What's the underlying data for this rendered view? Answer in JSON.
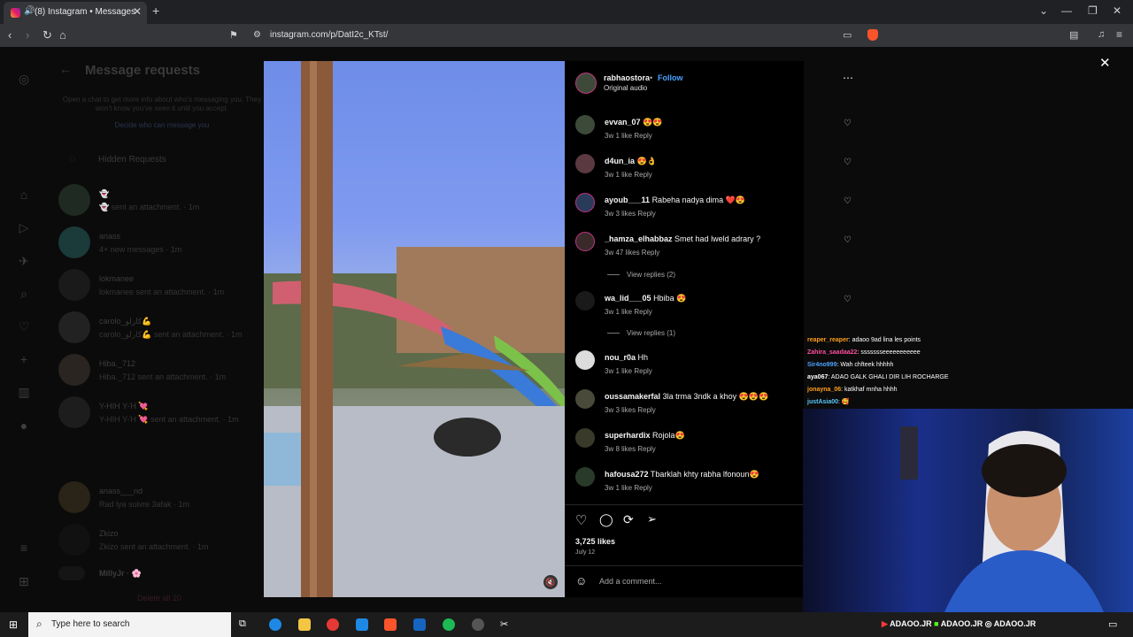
{
  "browser": {
    "tab_title": "(8) Instagram • Messages",
    "url": "instagram.com/p/DatI2c_KTst/"
  },
  "panel": {
    "title": "Message requests",
    "info": "Open a chat to get more info about who's messaging you. They won't know you've seen it until you accept.",
    "decide": "Decide who can message you",
    "hidden": "Hidden Requests",
    "delete_all": "Delete all 20",
    "requests": [
      {
        "name": "👻",
        "sub": "👻 sent an attachment. · 1m"
      },
      {
        "name": "anass",
        "sub": "4+ new messages · 1m"
      },
      {
        "name": "lokmanee",
        "sub": "lokmanee sent an attachment. · 1m"
      },
      {
        "name": "carolo_كارلو💪",
        "sub": "carolo_كارلو💪 sent an attachment. · 1m"
      },
      {
        "name": "Hiba._712",
        "sub": "Hiba._712 sent an attachment. · 1m"
      },
      {
        "name": "Y-ΗΙΗ Y-Ή 💘",
        "sub": "Y-ΗΙΗ Y-Ή 💘 sent an attachment. · 1m"
      },
      {
        "name": "anass___nd",
        "sub": "Rad lya suivre 3afak · 1m"
      },
      {
        "name": "Zkizo",
        "sub": "Zkizo sent an attachment. · 1m"
      },
      {
        "name": "MillyJr · 🌸",
        "sub": ""
      }
    ]
  },
  "post": {
    "author": "rabhaostora",
    "follow": "Follow",
    "audio": "Original audio",
    "likes": "3,725 likes",
    "date": "July 12",
    "comment_placeholder": "Add a comment..."
  },
  "comments": [
    {
      "user": "evvan_07",
      "text": "😍😍",
      "meta": "3w   1 like   Reply"
    },
    {
      "user": "d4un_ia",
      "text": "😍👌",
      "meta": "3w   1 like   Reply"
    },
    {
      "user": "ayoub___11",
      "text": "Rabeha nadya dima ❤️😍",
      "meta": "3w   3 likes   Reply"
    },
    {
      "user": "_hamza_elhabbaz",
      "text": "Smet had lweld adrary ?",
      "meta": "3w   47 likes   Reply",
      "replies": "View replies (2)"
    },
    {
      "user": "wa_lid___05",
      "text": "Hbiba 😍",
      "meta": "3w   1 like   Reply",
      "replies": "View replies (1)"
    },
    {
      "user": "nou_r0a",
      "text": "Hh",
      "meta": "3w   1 like   Reply"
    },
    {
      "user": "oussamakerfal",
      "text": "3la trma 3ndk a khoy 😍😍😍",
      "meta": "3w   3 likes   Reply"
    },
    {
      "user": "superhardix",
      "text": "Rojola😍",
      "meta": "3w   8 likes   Reply"
    },
    {
      "user": "hafousa272",
      "text": "Tbarklah khty rabha lfonoun😍",
      "meta": "3w   1 like   Reply"
    }
  ],
  "chat": [
    {
      "user": "reaper_reaper",
      "msg": ": adaoo 9ad lina les points",
      "color": "#ff9f1a"
    },
    {
      "user": "Zahira_saadaa22",
      "msg": ": ssssssseeeeeeeeeee",
      "color": "#ff4fa0"
    },
    {
      "user": "Sir4no999",
      "msg": ": Wah chfteek hhhhh",
      "color": "#4aa3ff"
    },
    {
      "user": "aya067",
      "msg": ": ADAO GALK GHALI DIR LIH ROCHARGE",
      "color": "#ffffff"
    },
    {
      "user": "jonayna_06",
      "msg": ": katkhaf mnha hhhh",
      "color": "#ff9f1a"
    },
    {
      "user": "justAsia00",
      "msg": ": 🥰",
      "color": "#5ac8fa"
    }
  ],
  "taskbar": {
    "search_placeholder": "Type here to search"
  },
  "social": {
    "handle": "ADAOO.JR"
  }
}
